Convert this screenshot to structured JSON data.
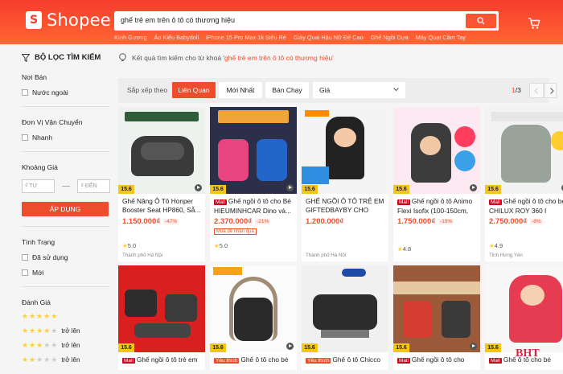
{
  "header": {
    "logo": "Shopee",
    "search_value": "ghế trẻ em trên ô tô có thương hiệu",
    "suggestions": [
      "Kính Gương",
      "Áo Kiểu Babydoll",
      "iPhone 15 Pro Max 1k Siêu Rẻ",
      "Giày Quai Hậu Nữ Đế Cao",
      "Ghế Ngồi Dựa",
      "Máy Quạt Cầm Tay"
    ]
  },
  "sidebar": {
    "title": "BỘ LỌC TÌM KIẾM",
    "origin": {
      "title": "Nơi Bán",
      "options": [
        "Nước ngoài"
      ]
    },
    "shipping": {
      "title": "Đơn Vị Vận Chuyển",
      "options": [
        "Nhanh"
      ]
    },
    "price": {
      "title": "Khoảng Giá",
      "from": "₫ TỪ",
      "to": "₫ ĐẾN",
      "apply": "ÁP DỤNG"
    },
    "condition": {
      "title": "Tình Trạng",
      "options": [
        "Đã sử dụng",
        "Mới"
      ]
    },
    "rating": {
      "title": "Đánh Giá",
      "more": "trở lên"
    }
  },
  "result": {
    "prefix": "Kết quả tìm kiếm cho từ khoá '",
    "keyword": "ghế trẻ em trên ô tô có thương hiệu",
    "suffix": "'"
  },
  "sortbar": {
    "label": "Sắp xếp theo",
    "options": [
      "Liên Quan",
      "Mới Nhất",
      "Bán Chạy"
    ],
    "price": "Giá",
    "page_current": "1",
    "page_total": "/3"
  },
  "products": [
    {
      "title": "Ghế Nâng Ô Tô Honper Booster Seat HP860, Sẵ...",
      "price": "1.150.000₫",
      "discount": "-47%",
      "rating": "5.0",
      "location": "Thành phố Hà Nội",
      "badge": "15.6",
      "label": ""
    },
    {
      "title": "Ghế ngồi ô tô cho Bé HIEUMINHCAR Dino và...",
      "price": "2.370.000₫",
      "discount": "-21%",
      "rating": "5.0",
      "location": "",
      "badge": "15.6",
      "label": "Mall",
      "tag": "Mua để nhận quà"
    },
    {
      "title": "GHẾ NGỒI Ô TÔ TRẺ EM GIFTEDBAYBY CHO TR...",
      "price": "1.200.000₫",
      "discount": "",
      "rating": "",
      "location": "Thành phố Hà Nội",
      "badge": "15.6",
      "label": ""
    },
    {
      "title": "Ghế ngồi ô tô Animo Flexi Isofix (100-150cm, i...",
      "price": "1.750.000₫",
      "discount": "-19%",
      "rating": "4.8",
      "location": "",
      "badge": "15.6",
      "label": "Mall"
    },
    {
      "title": "Ghế ngồi ô tô cho bé CHILUX ROY 360 I CS00...",
      "price": "2.750.000₫",
      "discount": "-8%",
      "rating": "4.9",
      "location": "Tỉnh Hưng Yên",
      "badge": "15.6",
      "label": "Mall"
    },
    {
      "title": "Ghế ngồi ô tô trẻ em",
      "badge": "15.6",
      "label": "Mall"
    },
    {
      "title": "Ghế ô tô cho bé",
      "badge": "15.6",
      "label": "Yêu thích"
    },
    {
      "title": "Ghế ô tô Chicco",
      "badge": "15.6",
      "label": "Yêu thích"
    },
    {
      "title": "Ghế ngồi ô tô cho",
      "badge": "15.6",
      "label": "Mall"
    },
    {
      "title": "Ghế ô tô cho bé",
      "badge": "15.6",
      "label": "Mall"
    }
  ],
  "watermark": "BHT",
  "colors": {
    "brand": "#ee4d2d",
    "header_top": "#f53d2d",
    "header_bottom": "#ff6633"
  }
}
